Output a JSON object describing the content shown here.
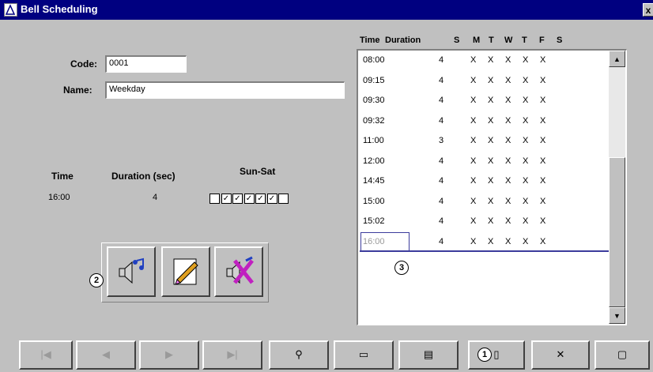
{
  "window": {
    "title": "Bell Scheduling",
    "close_glyph": "x"
  },
  "form": {
    "code_label": "Code:",
    "code_value": "0001",
    "name_label": "Name:",
    "name_value": "Weekday"
  },
  "detail": {
    "time_header": "Time",
    "duration_header": "Duration (sec)",
    "days_header": "Sun-Sat",
    "time_value": "16:00",
    "duration_value": "4",
    "days_checked": [
      false,
      true,
      true,
      true,
      true,
      true,
      false
    ]
  },
  "action_buttons": [
    {
      "name": "play-bell",
      "icon": "speaker-music-icon"
    },
    {
      "name": "edit-bell",
      "icon": "edit-pencil-icon"
    },
    {
      "name": "mute-bell",
      "icon": "speaker-x-icon"
    }
  ],
  "callouts": {
    "c1": "1",
    "c2": "2",
    "c3": "3"
  },
  "schedule": {
    "headers": {
      "time": "Time",
      "duration": "Duration",
      "days": [
        "S",
        "M",
        "T",
        "W",
        "T",
        "F",
        "S"
      ]
    },
    "rows": [
      {
        "time": "08:00",
        "duration": "4",
        "marks": [
          "X",
          "X",
          "X",
          "X",
          "X"
        ]
      },
      {
        "time": "09:15",
        "duration": "4",
        "marks": [
          "X",
          "X",
          "X",
          "X",
          "X"
        ]
      },
      {
        "time": "09:30",
        "duration": "4",
        "marks": [
          "X",
          "X",
          "X",
          "X",
          "X"
        ]
      },
      {
        "time": "09:32",
        "duration": "4",
        "marks": [
          "X",
          "X",
          "X",
          "X",
          "X"
        ]
      },
      {
        "time": "11:00",
        "duration": "3",
        "marks": [
          "X",
          "X",
          "X",
          "X",
          "X"
        ]
      },
      {
        "time": "12:00",
        "duration": "4",
        "marks": [
          "X",
          "X",
          "X",
          "X",
          "X"
        ]
      },
      {
        "time": "14:45",
        "duration": "4",
        "marks": [
          "X",
          "X",
          "X",
          "X",
          "X"
        ]
      },
      {
        "time": "15:00",
        "duration": "4",
        "marks": [
          "X",
          "X",
          "X",
          "X",
          "X"
        ]
      },
      {
        "time": "15:02",
        "duration": "4",
        "marks": [
          "X",
          "X",
          "X",
          "X",
          "X"
        ]
      },
      {
        "time": "16:00",
        "duration": "4",
        "marks": [
          "X",
          "X",
          "X",
          "X",
          "X"
        ]
      }
    ],
    "selected_index": 9
  },
  "scrollbar": {
    "up_glyph": "▲",
    "down_glyph": "▼"
  },
  "toolbar": [
    {
      "name": "first-record-button",
      "glyph": "|◀",
      "disabled": true
    },
    {
      "name": "prev-record-button",
      "glyph": "◀",
      "disabled": true
    },
    {
      "name": "next-record-button",
      "glyph": "▶",
      "disabled": true
    },
    {
      "name": "last-record-button",
      "glyph": "▶|",
      "disabled": true
    },
    {
      "name": "find-button",
      "glyph": "⚲",
      "disabled": false
    },
    {
      "name": "list-button",
      "glyph": "▭",
      "disabled": false
    },
    {
      "name": "print-button",
      "glyph": "▤",
      "disabled": false
    },
    {
      "name": "new-record-button",
      "glyph": "▯",
      "disabled": false
    },
    {
      "name": "delete-record-button",
      "glyph": "✕",
      "disabled": false
    },
    {
      "name": "open-button",
      "glyph": "▢",
      "disabled": false
    }
  ],
  "colors": {
    "title_bar": "#000080",
    "face": "#c0c0c0",
    "selection": "#3c3c9c"
  }
}
